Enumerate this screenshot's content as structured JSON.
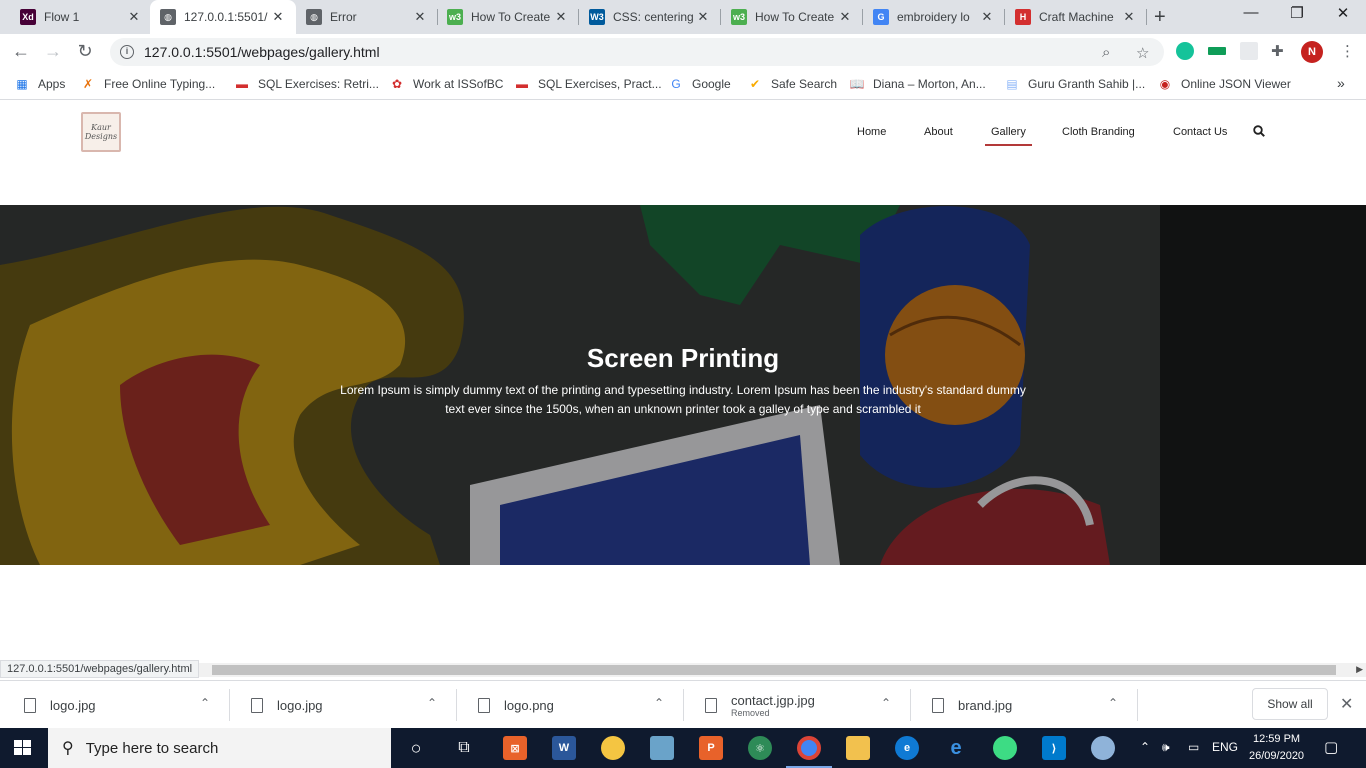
{
  "browser": {
    "tabs": [
      {
        "title": "Flow 1",
        "icon": "xd-icon",
        "color": "#470137",
        "glyph": "Xd"
      },
      {
        "title": "127.0.0.1:5501/",
        "icon": "globe-icon",
        "color": "#5f6368",
        "glyph": "◍",
        "active": true
      },
      {
        "title": "Error",
        "icon": "globe-icon",
        "color": "#5f6368",
        "glyph": "◍"
      },
      {
        "title": "How To Create",
        "icon": "w3schools-icon",
        "color": "#4caf50",
        "glyph": "w3"
      },
      {
        "title": "CSS: centering",
        "icon": "w3c-icon",
        "color": "#005a9c",
        "glyph": "W3"
      },
      {
        "title": "How To Create",
        "icon": "w3schools-icon",
        "color": "#4caf50",
        "glyph": "w3"
      },
      {
        "title": "embroidery lo",
        "icon": "google-icon",
        "color": "#4285f4",
        "glyph": "G"
      },
      {
        "title": "Craft Machine",
        "icon": "craft-icon",
        "color": "#d32f2f",
        "glyph": "H"
      }
    ],
    "new_tab": "+",
    "window": {
      "minimize": "—",
      "maximize": "❐",
      "close": "✕"
    },
    "address": "127.0.0.1:5501/webpages/gallery.html",
    "avatar_letter": "N",
    "bookmarks": [
      {
        "label": "Apps",
        "icon": "apps-grid-icon",
        "glyph": "▦",
        "color": "#1a73e8"
      },
      {
        "label": "Free Online Typing...",
        "icon": "typing-icon",
        "glyph": "✗",
        "color": "#e8710a"
      },
      {
        "label": "SQL Exercises: Retri...",
        "icon": "w3resource-icon",
        "glyph": "▬",
        "color": "#d32f2f"
      },
      {
        "label": "Work at ISSofBC",
        "icon": "issofbc-icon",
        "glyph": "✿",
        "color": "#d32f2f"
      },
      {
        "label": "SQL Exercises, Pract...",
        "icon": "w3resource-icon",
        "glyph": "▬",
        "color": "#d32f2f"
      },
      {
        "label": "Google",
        "icon": "google-icon",
        "glyph": "G",
        "color": "#4285f4"
      },
      {
        "label": "Safe Search",
        "icon": "check-icon",
        "glyph": "✔",
        "color": "#f9ab00"
      },
      {
        "label": "Diana – Morton, An...",
        "icon": "book-icon",
        "glyph": "📖",
        "color": "#3c4043"
      },
      {
        "label": "Guru Granth Sahib |...",
        "icon": "document-icon",
        "glyph": "▤",
        "color": "#8ab4f8"
      },
      {
        "label": "Online JSON Viewer",
        "icon": "json-viewer-icon",
        "glyph": "◉",
        "color": "#c5221f"
      }
    ],
    "bookmarks_more": "»",
    "status_url": "127.0.0.1:5501/webpages/gallery.html"
  },
  "site": {
    "logo_text": "Kaur\nDesigns",
    "nav": [
      {
        "label": "Home"
      },
      {
        "label": "About"
      },
      {
        "label": "Gallery",
        "active": true
      },
      {
        "label": "Cloth Branding"
      },
      {
        "label": "Contact Us"
      }
    ],
    "hero": {
      "title": "Screen Printing",
      "text": "Lorem Ipsum is simply dummy text of the printing and typesetting industry. Lorem Ipsum has been the industry's standard dummy text ever since the 1500s, when an unknown printer took a galley of type and scrambled it"
    },
    "accent": "#b33939"
  },
  "downloads": {
    "items": [
      {
        "name": "logo.jpg",
        "sub": ""
      },
      {
        "name": "logo.jpg",
        "sub": ""
      },
      {
        "name": "logo.png",
        "sub": ""
      },
      {
        "name": "contact.jgp.jpg",
        "sub": "Removed"
      },
      {
        "name": "brand.jpg",
        "sub": ""
      }
    ],
    "show_all": "Show all"
  },
  "taskbar": {
    "search_placeholder": "Type here to search",
    "lang": "ENG",
    "time": "12:59 PM",
    "date": "26/09/2020"
  }
}
